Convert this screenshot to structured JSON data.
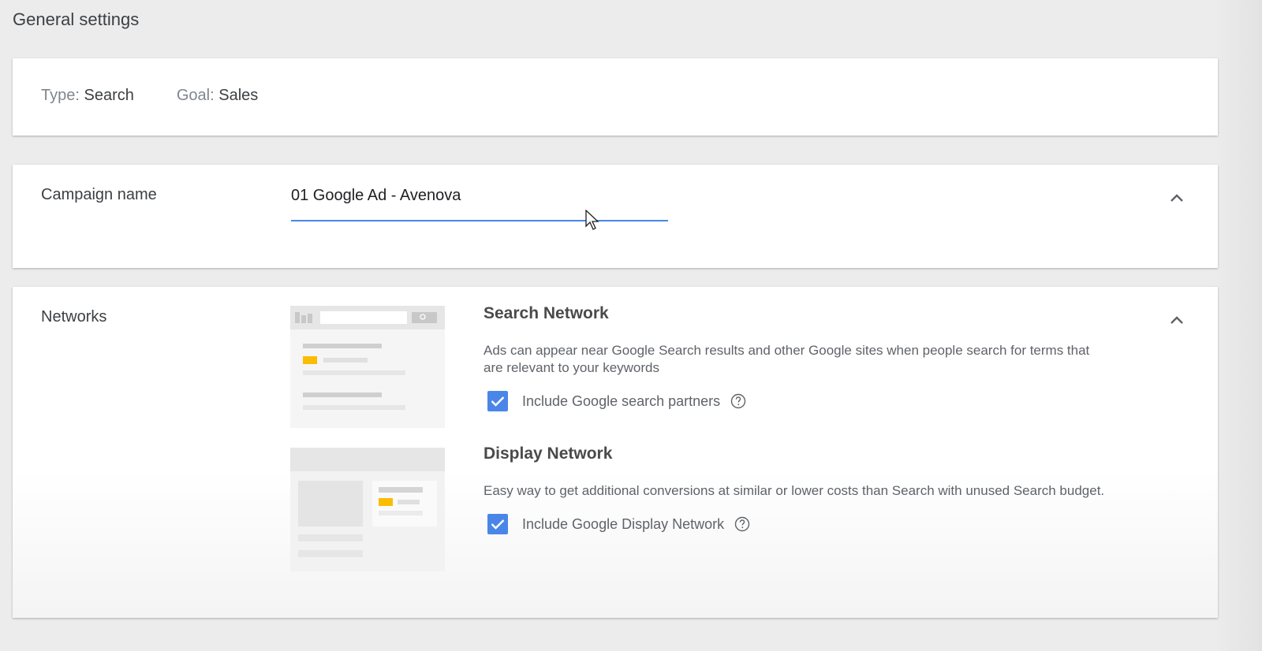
{
  "page": {
    "title": "General settings"
  },
  "summary": {
    "type_label": "Type:",
    "type_value": "Search",
    "goal_label": "Goal:",
    "goal_value": "Sales"
  },
  "campaign": {
    "label": "Campaign name",
    "value": "01 Google Ad - Avenova"
  },
  "networks": {
    "label": "Networks",
    "search": {
      "title": "Search Network",
      "description": "Ads can appear near Google Search results and other Google sites when people search for terms that are relevant to your keywords",
      "checkbox_label": "Include Google search partners",
      "checked": true
    },
    "display": {
      "title": "Display Network",
      "description": "Easy way to get additional conversions at similar or lower costs than Search with unused Search budget.",
      "checkbox_label": "Include Google Display Network",
      "checked": true
    }
  },
  "icons": {
    "collapse": "chevron-up-icon",
    "help": "help-circle-icon",
    "check": "check-icon",
    "cursor": "mouse-pointer-icon"
  },
  "colors": {
    "accent": "#4a86e8",
    "highlight": "#fbbc04",
    "background": "#ececec"
  }
}
